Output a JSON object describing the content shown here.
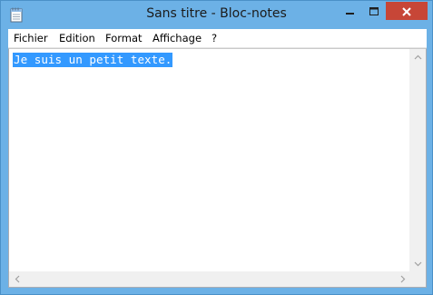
{
  "window": {
    "title": "Sans titre - Bloc-notes"
  },
  "title_buttons": {
    "minimize_icon": "minimize-icon",
    "maximize_icon": "maximize-icon",
    "close_icon": "close-icon"
  },
  "menu": {
    "items": [
      {
        "label": "Fichier"
      },
      {
        "label": "Edition"
      },
      {
        "label": "Format"
      },
      {
        "label": "Affichage"
      },
      {
        "label": "?"
      }
    ]
  },
  "editor": {
    "content": "Je suis un petit texte.",
    "selected": true
  },
  "colors": {
    "titlebar": "#6cb1e6",
    "close_button": "#c74637",
    "selection": "#3399ff"
  }
}
